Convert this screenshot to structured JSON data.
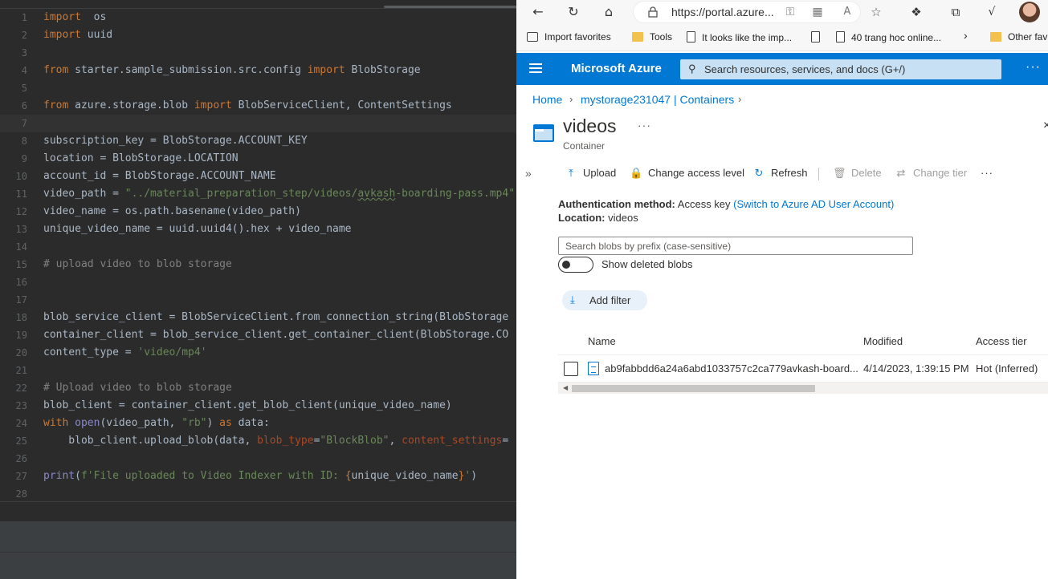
{
  "editor": {
    "lines": [
      {
        "n": "1",
        "tokens": [
          [
            "kw",
            "import"
          ],
          [
            "",
            "  os"
          ]
        ]
      },
      {
        "n": "2",
        "tokens": [
          [
            "kw",
            "import"
          ],
          [
            "",
            " uuid"
          ]
        ]
      },
      {
        "n": "3",
        "tokens": []
      },
      {
        "n": "4",
        "tokens": [
          [
            "kw",
            "from"
          ],
          [
            "",
            " starter.sample_submission.src.config "
          ],
          [
            "kw",
            "import"
          ],
          [
            "",
            " BlobStorage"
          ]
        ]
      },
      {
        "n": "5",
        "tokens": []
      },
      {
        "n": "6",
        "tokens": [
          [
            "kw",
            "from"
          ],
          [
            "",
            " azure.storage.blob "
          ],
          [
            "kw",
            "import"
          ],
          [
            "",
            " BlobServiceClient, ContentSettings"
          ]
        ]
      },
      {
        "n": "7",
        "tokens": [],
        "current": true
      },
      {
        "n": "8",
        "tokens": [
          [
            "",
            "subscription_key = BlobStorage.ACCOUNT_KEY"
          ]
        ]
      },
      {
        "n": "9",
        "tokens": [
          [
            "",
            "location = BlobStorage.LOCATION"
          ]
        ]
      },
      {
        "n": "10",
        "tokens": [
          [
            "",
            "account_id = BlobStorage.ACCOUNT_NAME"
          ]
        ]
      },
      {
        "n": "11",
        "tokens": [
          [
            "",
            "video_path = "
          ],
          [
            "str",
            "\"../material_preparation_step/videos/"
          ],
          [
            "str squig",
            "avkash"
          ],
          [
            "str",
            "-boarding-pass.mp4\""
          ]
        ]
      },
      {
        "n": "12",
        "tokens": [
          [
            "",
            "video_name = os.path.basename(video_path)"
          ]
        ]
      },
      {
        "n": "13",
        "tokens": [
          [
            "",
            "unique_video_name = uuid.uuid4().hex + video_name"
          ]
        ]
      },
      {
        "n": "14",
        "tokens": []
      },
      {
        "n": "15",
        "tokens": [
          [
            "cm",
            "# upload video to blob storage"
          ]
        ]
      },
      {
        "n": "16",
        "tokens": []
      },
      {
        "n": "17",
        "tokens": []
      },
      {
        "n": "18",
        "tokens": [
          [
            "",
            "blob_service_client = BlobServiceClient.from_connection_string(BlobStorage"
          ]
        ]
      },
      {
        "n": "19",
        "tokens": [
          [
            "",
            "container_client = blob_service_client.get_container_client(BlobStorage.CO"
          ]
        ]
      },
      {
        "n": "20",
        "tokens": [
          [
            "",
            "content_type = "
          ],
          [
            "str",
            "'video/mp4'"
          ]
        ]
      },
      {
        "n": "21",
        "tokens": []
      },
      {
        "n": "22",
        "tokens": [
          [
            "cm",
            "# Upload video to blob storage"
          ]
        ]
      },
      {
        "n": "23",
        "tokens": [
          [
            "",
            "blob_client = container_client.get_blob_client(unique_video_name)"
          ]
        ]
      },
      {
        "n": "24",
        "tokens": [
          [
            "kw",
            "with"
          ],
          [
            "",
            " "
          ],
          [
            "fn",
            "open"
          ],
          [
            "",
            "(video_path, "
          ],
          [
            "str",
            "\"rb\""
          ],
          [
            "",
            ") "
          ],
          [
            "kw",
            "as"
          ],
          [
            "",
            " data:"
          ]
        ]
      },
      {
        "n": "25",
        "tokens": [
          [
            "",
            "    blob_client.upload_blob(data, "
          ],
          [
            "prm",
            "blob_type"
          ],
          [
            "",
            "="
          ],
          [
            "str",
            "\"BlockBlob\""
          ],
          [
            "",
            ", "
          ],
          [
            "prm",
            "content_settings"
          ],
          [
            "",
            "="
          ]
        ]
      },
      {
        "n": "26",
        "tokens": []
      },
      {
        "n": "27",
        "tokens": [
          [
            "fn",
            "print"
          ],
          [
            "",
            "("
          ],
          [
            "str",
            "f'File uploaded to Video Indexer with ID: "
          ],
          [
            "kw",
            "{"
          ],
          [
            "",
            "unique_video_name"
          ],
          [
            "kw",
            "}"
          ],
          [
            "str",
            "'"
          ],
          [
            "",
            ")"
          ]
        ]
      },
      {
        "n": "28",
        "tokens": []
      }
    ]
  },
  "browser": {
    "url": "https://portal.azure...",
    "favorites": [
      {
        "label": "Import favorites",
        "icon": "import-icon"
      },
      {
        "label": "Tools",
        "icon": "folder-icon"
      },
      {
        "label": "It looks like the imp...",
        "icon": "page-icon"
      },
      {
        "label": "",
        "icon": "page-icon"
      },
      {
        "label": "40 trang hoc online...",
        "icon": "page-icon"
      },
      {
        "label": "Other fav",
        "icon": "folder-icon"
      }
    ]
  },
  "azure": {
    "brand": "Microsoft Azure",
    "search_placeholder": "Search resources, services, and docs (G+/)",
    "breadcrumb": [
      "Home",
      "mystorage231047 | Containers"
    ],
    "title": "videos",
    "subtitle": "Container",
    "commands": {
      "upload": "Upload",
      "access": "Change access level",
      "refresh": "Refresh",
      "delete": "Delete",
      "tier": "Change tier"
    },
    "auth_label": "Authentication method:",
    "auth_value": "Access key",
    "auth_link": "(Switch to Azure AD User Account)",
    "location_label": "Location:",
    "location_value": "videos",
    "blob_search_placeholder": "Search blobs by prefix (case-sensitive)",
    "show_deleted_label": "Show deleted blobs",
    "show_deleted_on": false,
    "add_filter": "Add filter",
    "columns": [
      "Name",
      "Modified",
      "Access tier"
    ],
    "rows": [
      {
        "name": "ab9fabbdd6a24a6abd1033757c2ca779avkash-board...",
        "modified": "4/14/2023, 1:39:15 PM",
        "tier": "Hot (Inferred)"
      }
    ]
  }
}
